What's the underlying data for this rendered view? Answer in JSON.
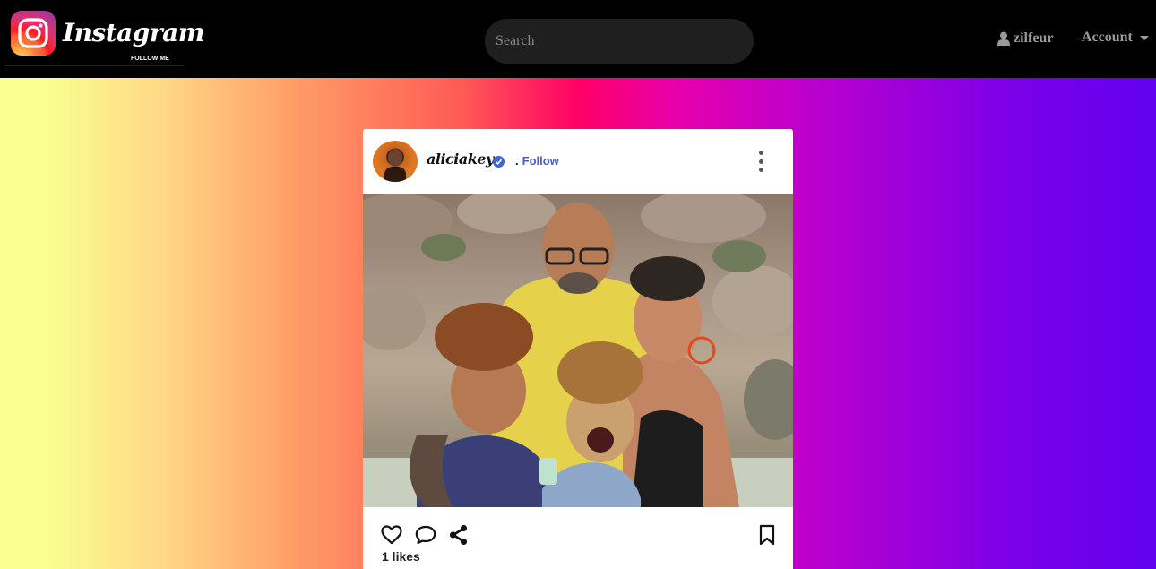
{
  "navbar": {
    "logo_text": "Instagram",
    "logo_subtext": "FOLLOW ME",
    "search_placeholder": "Search",
    "username": "zilfeur",
    "account_label": "Account",
    "icons": {
      "logo": "instagram-icon",
      "user": "user-icon",
      "dropdown": "caret-down-icon"
    }
  },
  "post": {
    "username": "aliciakeys",
    "separator": ".",
    "follow_label": "Follow",
    "likes_text": "1 likes",
    "icons": {
      "verified": "verified-badge-icon",
      "more": "more-vertical-icon",
      "like": "heart-icon",
      "comment": "comment-icon",
      "share": "share-icon",
      "save": "bookmark-icon"
    }
  },
  "colors": {
    "navbar_bg": "#000000",
    "follow_link": "#4a5ccf",
    "verified_badge": "#3b66d6",
    "background_gradient": [
      "#f9ff91",
      "#ff9a66",
      "#ff0066",
      "#c400c9",
      "#6200f0"
    ]
  }
}
